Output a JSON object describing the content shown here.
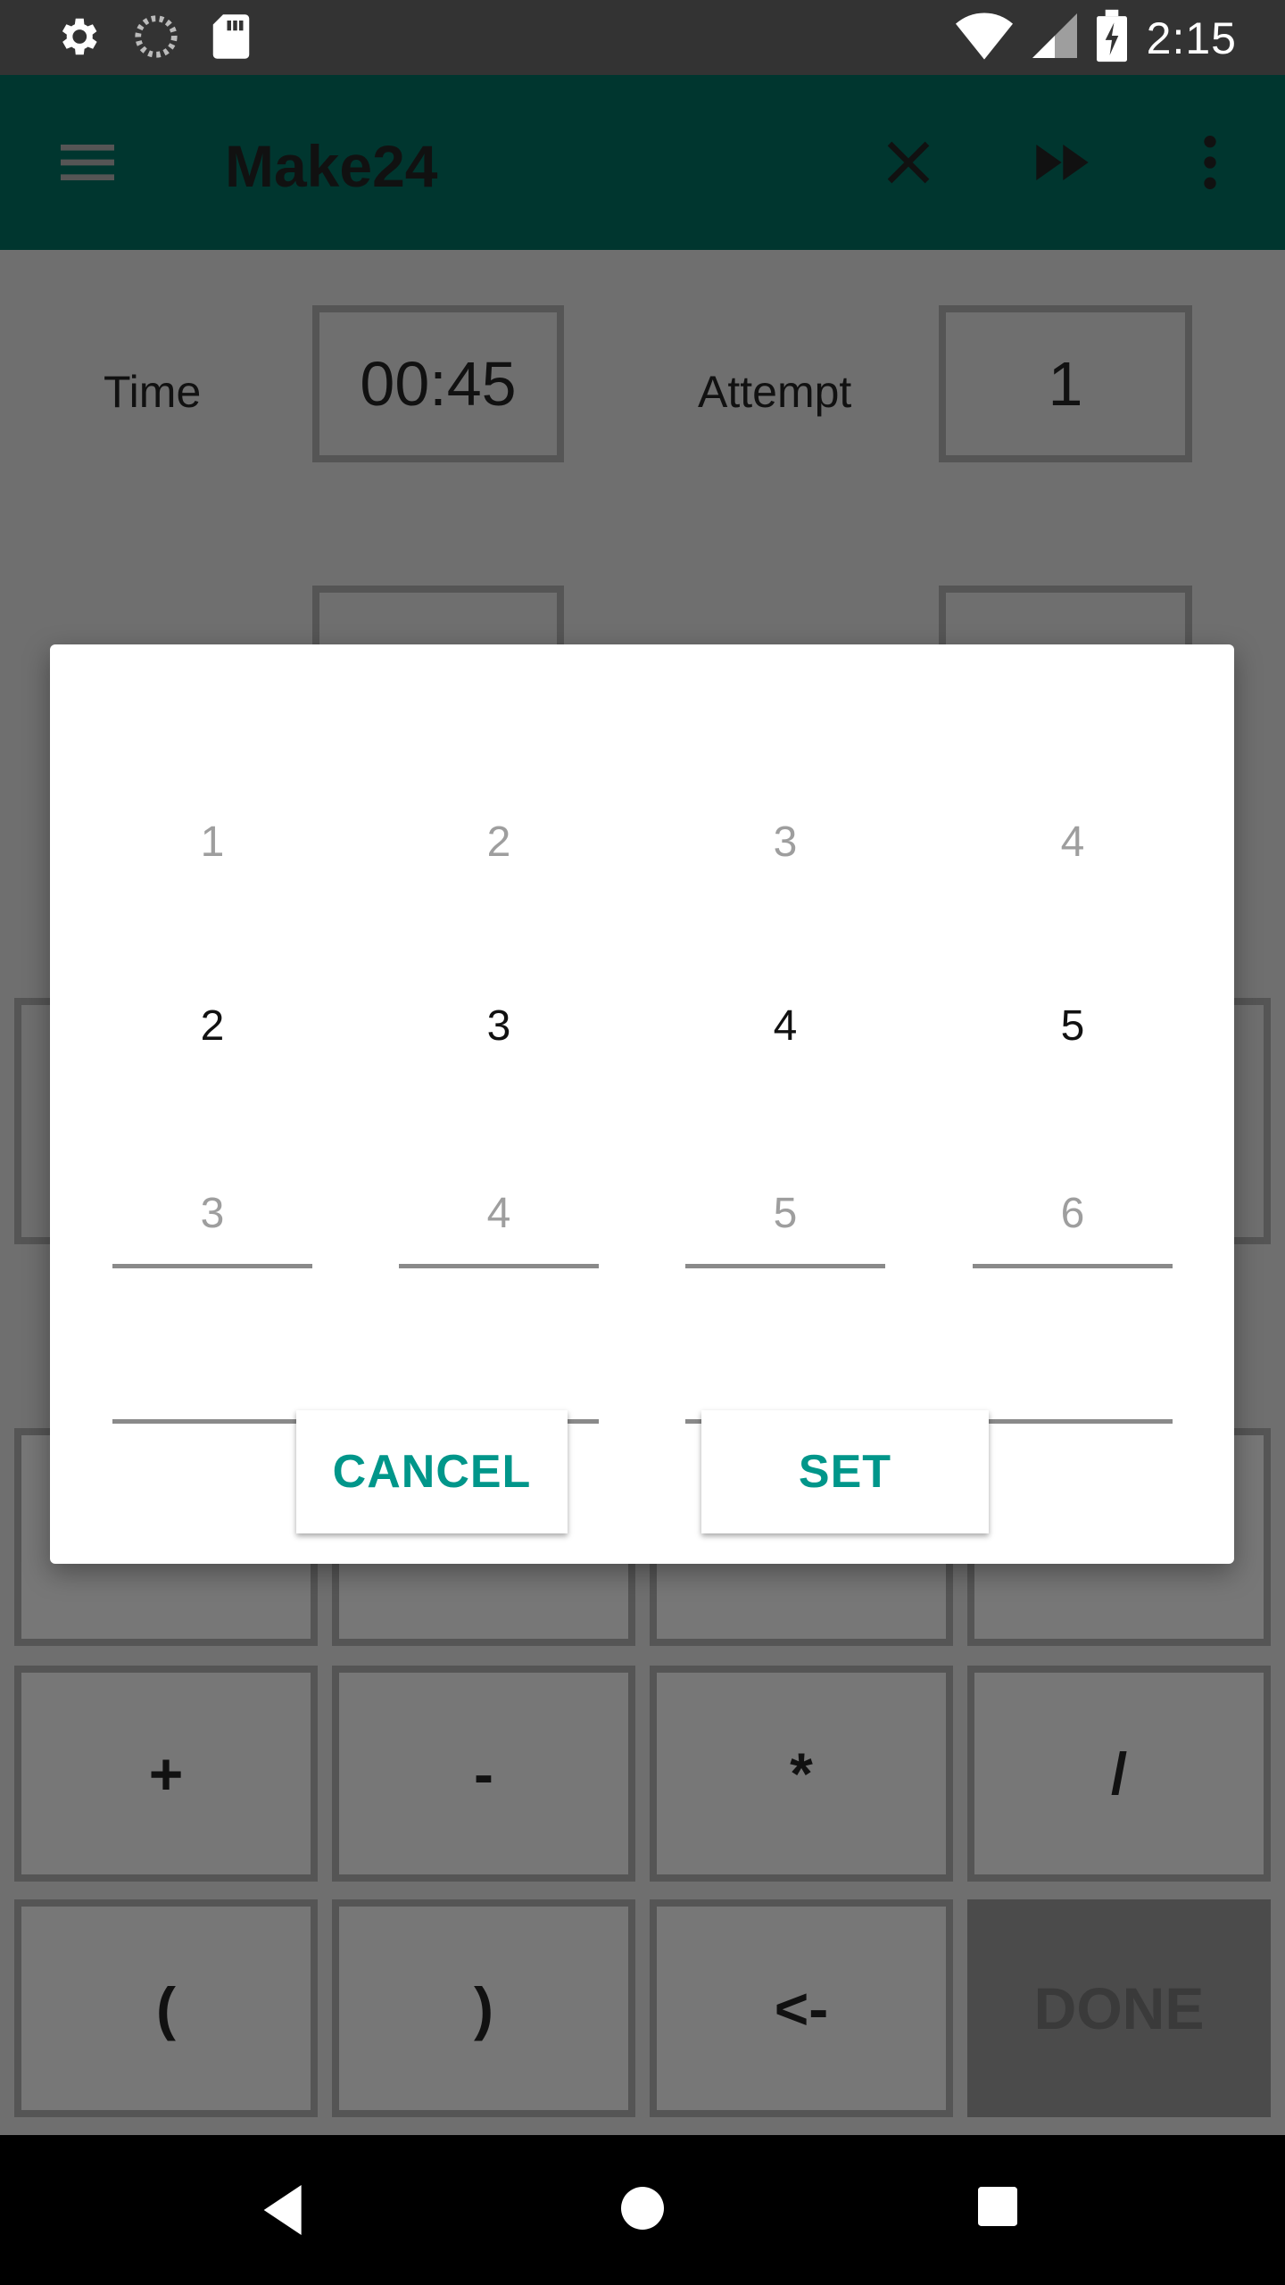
{
  "status_bar": {
    "clock": "2:15",
    "left_icons": [
      "gear-icon",
      "loading-icon",
      "sd-card-icon"
    ],
    "right_icons": [
      "wifi-icon",
      "signal-icon",
      "battery-charging-icon"
    ]
  },
  "app_bar": {
    "title": "Make24",
    "menu_icon": "hamburger-icon",
    "actions": [
      "close-icon",
      "fast-forward-icon",
      "more-vert-icon"
    ],
    "color": "#00362f"
  },
  "stats": {
    "time_label": "Time",
    "time_value": "00:45",
    "attempt_label": "Attempt",
    "attempt_value": "1"
  },
  "keypad": {
    "row1": [
      "+",
      "-",
      "*",
      "/"
    ],
    "row2": [
      "(",
      ")",
      "<-",
      "DONE"
    ]
  },
  "dialog": {
    "pickers": [
      {
        "prev": "1",
        "current": "2",
        "next": "3"
      },
      {
        "prev": "2",
        "current": "3",
        "next": "4"
      },
      {
        "prev": "3",
        "current": "4",
        "next": "5"
      },
      {
        "prev": "4",
        "current": "5",
        "next": "6"
      }
    ],
    "cancel_label": "CANCEL",
    "set_label": "SET",
    "accent_color": "#00968a"
  },
  "nav_bar": {
    "icons": [
      "back-icon",
      "home-icon",
      "recents-icon"
    ]
  }
}
